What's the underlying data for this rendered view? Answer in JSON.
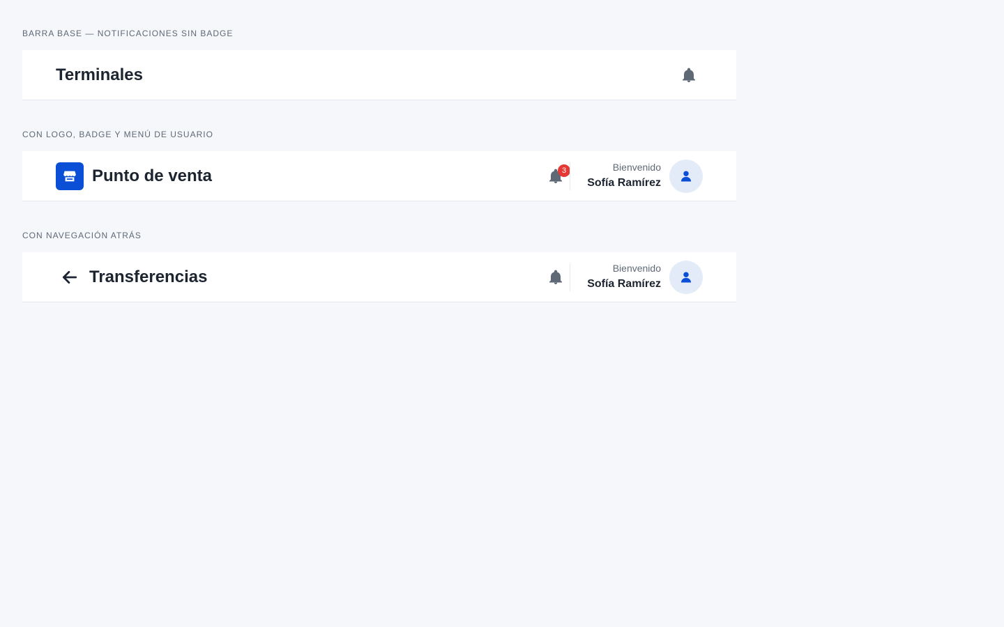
{
  "sections": [
    {
      "label": "BARRA BASE — NOTIFICACIONES SIN BADGE",
      "bar": {
        "title": "Terminales",
        "icons": [
          "bell-icon"
        ]
      }
    },
    {
      "label": "CON LOGO, BADGE Y MENÚ DE USUARIO",
      "bar": {
        "title": "Punto de venta",
        "icons": [
          "store-logo-icon",
          "bell-icon",
          "user-icon"
        ],
        "badge_count": "3",
        "user": {
          "greeting": "Bienvenido",
          "name": "Sofía Ramírez"
        }
      }
    },
    {
      "label": "CON NAVEGACIÓN ATRÁS",
      "bar": {
        "title": "Transferencias",
        "icons": [
          "arrow-left-icon",
          "bell-icon",
          "user-icon"
        ],
        "user": {
          "greeting": "Bienvenido",
          "name": "Sofía Ramírez"
        }
      }
    }
  ],
  "colors": {
    "background": "#f5f7fb",
    "bar_background": "#ffffff",
    "brand": "#0a4fd6",
    "badge": "#e53935",
    "icon": "#5f6875",
    "avatar_background": "#e4ebf8",
    "text": "#1c2430"
  }
}
